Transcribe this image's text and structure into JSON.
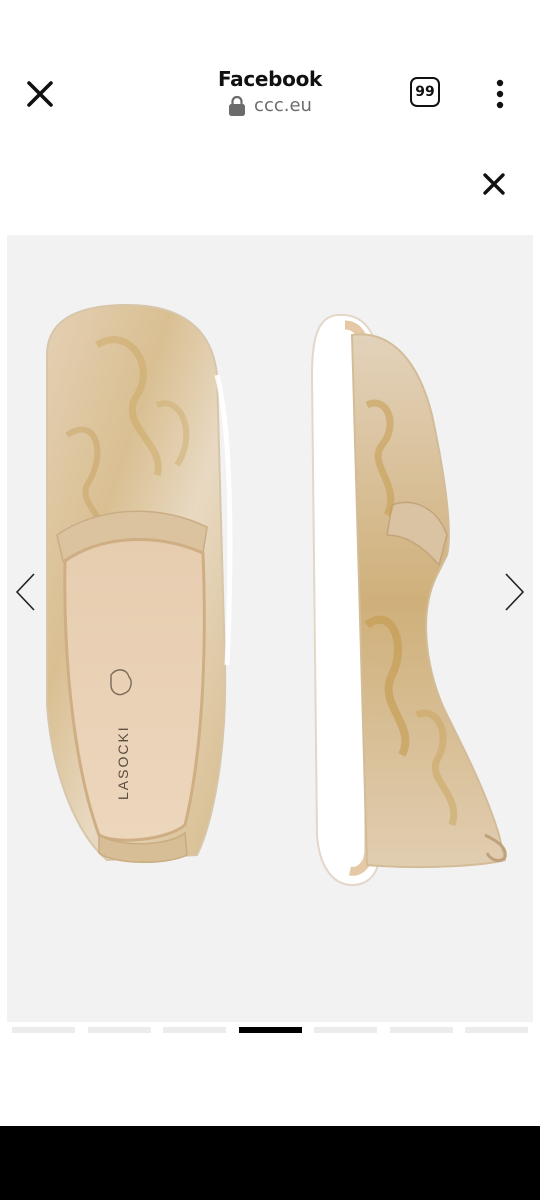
{
  "browser": {
    "title": "Facebook",
    "url": "ccc.eu",
    "tab_count": "99",
    "icons": {
      "close": "close-icon",
      "lock": "lock-icon",
      "more": "more-vertical-icon"
    }
  },
  "gallery": {
    "close_icon": "close-icon",
    "prev_icon": "chevron-left-icon",
    "next_icon": "chevron-right-icon",
    "image": {
      "brand_text": "LASOCKI",
      "description": "gold floral slip-on shoes"
    },
    "pager": {
      "total": 7,
      "active_index": 3
    }
  },
  "colors": {
    "background": "#ffffff",
    "image_bg": "#f2f2f2",
    "pager_inactive": "#ececec",
    "pager_active": "#000000",
    "system_bar": "#000000"
  }
}
